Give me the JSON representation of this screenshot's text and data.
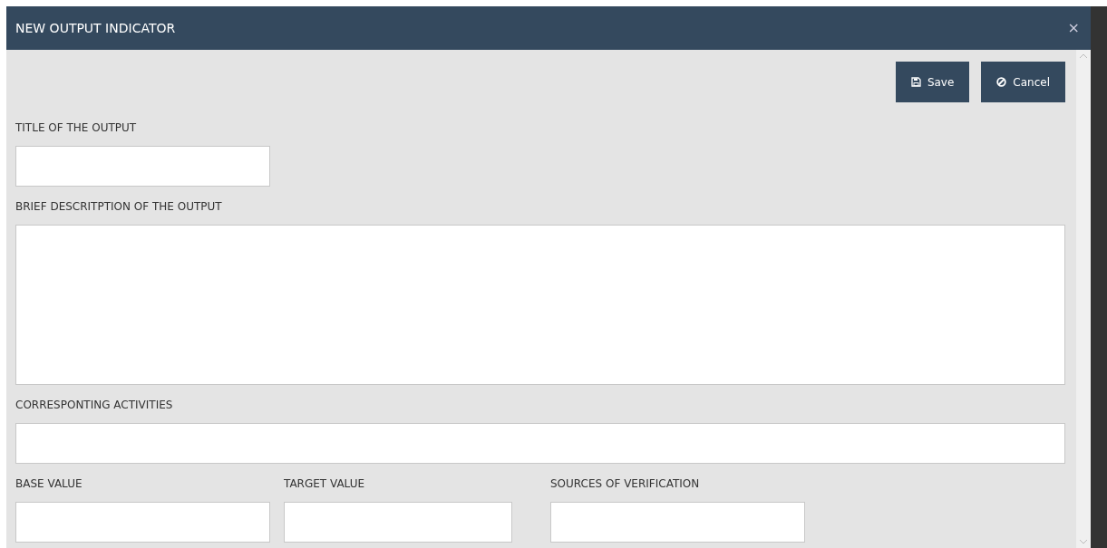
{
  "dialog": {
    "title": "NEW OUTPUT INDICATOR",
    "close": "×"
  },
  "buttons": [
    {
      "kind": "save",
      "label": "Save"
    },
    {
      "kind": "cancel",
      "label": "Cancel"
    }
  ],
  "fields": [
    {
      "label": "TITLE OF THE OUTPUT",
      "kind": "short"
    },
    {
      "label": "BRIEF DESCRITPTION OF THE OUTPUT",
      "kind": "textarea"
    },
    {
      "label": "CORRESPONTING ACTIVITIES",
      "kind": "wide"
    }
  ],
  "bottom_fields": [
    {
      "label": "BASE VALUE"
    },
    {
      "label": "TARGET VALUE"
    },
    {
      "label": "SOURCES OF VERIFICATION"
    }
  ]
}
